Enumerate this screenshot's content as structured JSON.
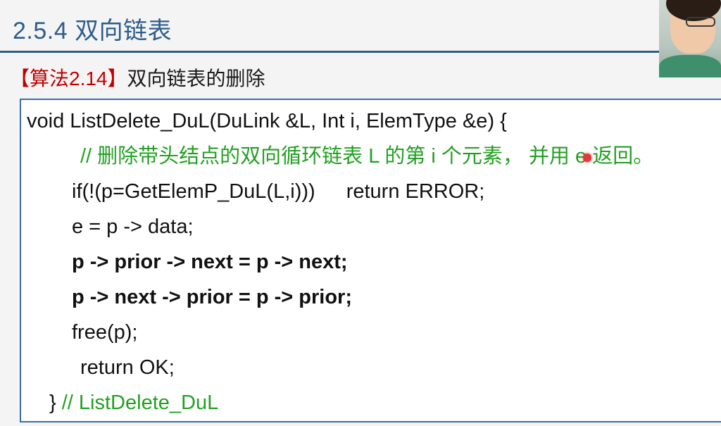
{
  "slide": {
    "section_title": "2.5.4 双向链表",
    "algo_tag": "【算法2.14】",
    "algo_title": "双向链表的删除"
  },
  "code": {
    "line1": "void ListDelete_DuL(DuLink &L, Int i, ElemType &e) {",
    "line2_comment": "// 删除带头结点的双向循环链表 L 的第 i 个元素， 并用 e 返回。",
    "line3_a": "if(!(p=GetElemP_DuL(L,i)))",
    "line3_b": "return ERROR;",
    "line4": "e = p -> data;",
    "line5": "p -> prior -> next = p -> next;",
    "line6": "p -> next -> prior = p -> prior;",
    "line7": "free(p);",
    "line8": "return OK;",
    "line9_brace": "}",
    "line9_comment": "// ListDelete_DuL"
  },
  "colors": {
    "title": "#2e5c8a",
    "tag": "#c00000",
    "comment": "#22a022",
    "border": "#3b6ea5"
  }
}
